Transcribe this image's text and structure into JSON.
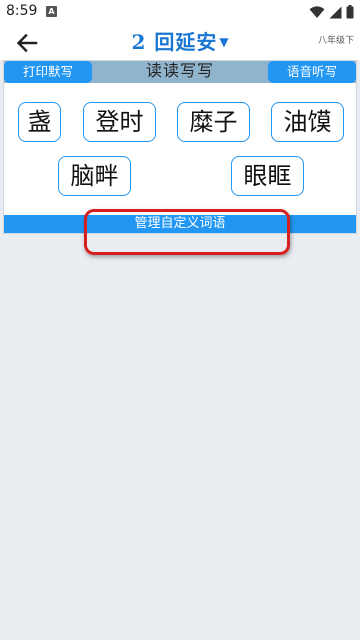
{
  "status_bar": {
    "time": "8:59",
    "notification_badge": "A",
    "icons": [
      "wifi-icon",
      "cellular-signal-icon",
      "battery-icon"
    ]
  },
  "header": {
    "title": "2 回延安",
    "dropdown_icon": "caret-down-icon",
    "grade": "八年级下",
    "back_icon": "back-arrow-icon"
  },
  "toolbar": {
    "print_label": "打印默写",
    "center_title": "读读写写",
    "audio_label": "语音听写"
  },
  "words": [
    "盏",
    "登时",
    "糜子",
    "油馍",
    "脑畔",
    "眼眶"
  ],
  "manage_label": "管理自定义词语",
  "colors": {
    "accent": "#2196f3",
    "title": "#1976d2",
    "highlight": "#d62020",
    "tab_row_bg": "#90b4cc",
    "page_bg": "#e9ecf0"
  }
}
